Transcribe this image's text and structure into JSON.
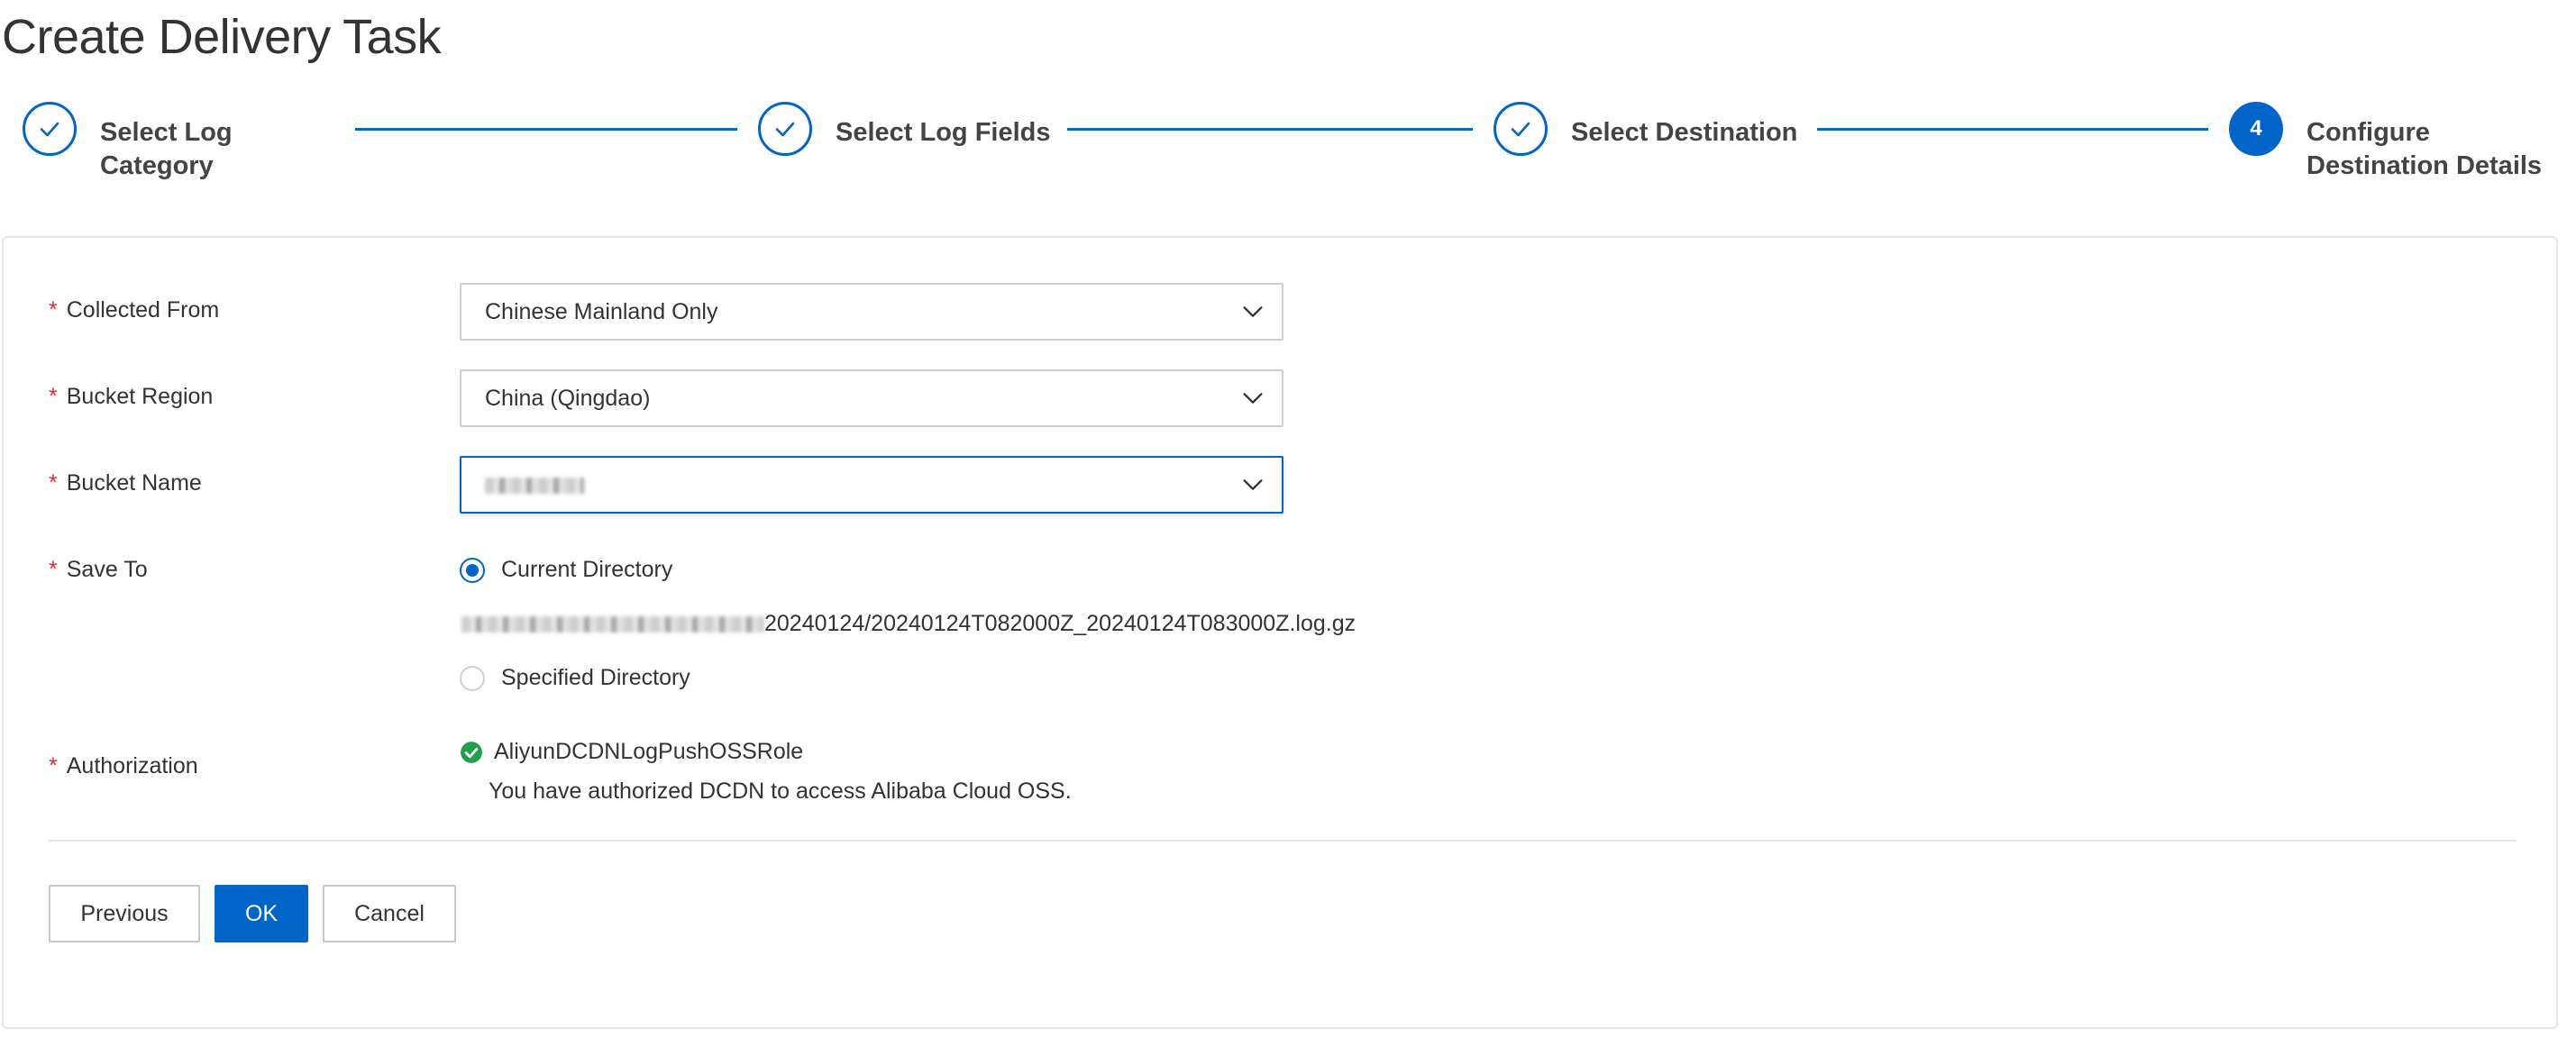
{
  "page": {
    "title": "Create Delivery Task"
  },
  "steps": [
    {
      "label_line1": "Select Log",
      "label_line2": "Category",
      "status": "done"
    },
    {
      "label_line1": "Select Log Fields",
      "label_line2": "",
      "status": "done"
    },
    {
      "label_line1": "Select Destination",
      "label_line2": "",
      "status": "done"
    },
    {
      "number": "4",
      "label_line1": "Configure",
      "label_line2": "Destination Details",
      "status": "active"
    }
  ],
  "form": {
    "required_mark": "*",
    "collected_from": {
      "label": "Collected From",
      "value": "Chinese Mainland Only"
    },
    "bucket_region": {
      "label": "Bucket Region",
      "value": "China (Qingdao)"
    },
    "bucket_name": {
      "label": "Bucket Name",
      "value": ""
    },
    "save_to": {
      "label": "Save To",
      "option_current": "Current Directory",
      "path_suffix": "20240124/20240124T082000Z_20240124T083000Z.log.gz",
      "option_specified": "Specified Directory",
      "selected": "Current Directory"
    },
    "authorization": {
      "label": "Authorization",
      "role": "AliyunDCDNLogPushOSSRole",
      "description": "You have authorized DCDN to access Alibaba Cloud OSS."
    }
  },
  "buttons": {
    "previous": "Previous",
    "ok": "OK",
    "cancel": "Cancel"
  },
  "colors": {
    "primary": "#0064c8",
    "required": "#d93026",
    "success": "#1ea14a"
  },
  "icons": {
    "step_done": "check-icon",
    "select_arrow": "chevron-down-icon",
    "auth_ok": "check-circle-icon"
  }
}
